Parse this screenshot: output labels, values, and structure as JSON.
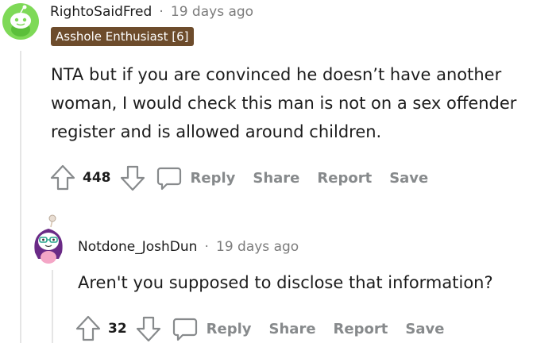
{
  "comments": [
    {
      "username": "RightoSaidFred",
      "separator": "·",
      "time": "19 days ago",
      "flair": "Asshole Enthusiast [6]",
      "body_lines": [
        "NTA but if you are convinced he doesn’t have another",
        "woman, I would check this man is not on a sex offender",
        "register and is allowed around children."
      ],
      "score": "448",
      "actions": {
        "reply": "Reply",
        "share": "Share",
        "report": "Report",
        "save": "Save"
      }
    },
    {
      "username": "Notdone_JoshDun",
      "separator": "·",
      "time": "19 days ago",
      "body_lines": [
        "Aren't you supposed to disclose that information?"
      ],
      "score": "32",
      "actions": {
        "reply": "Reply",
        "share": "Share",
        "report": "Report",
        "save": "Save"
      }
    }
  ],
  "icons": {
    "avatar_1": "snoo-avatar-green",
    "avatar_2": "snoo-avatar-purple-hair",
    "upvote": "upvote-arrow-icon",
    "downvote": "downvote-arrow-icon",
    "comment": "comment-bubble-icon"
  },
  "colors": {
    "flair_bg": "#6d4c2c",
    "avatar_green": "#7ed957",
    "action_gray": "#878a8c"
  }
}
